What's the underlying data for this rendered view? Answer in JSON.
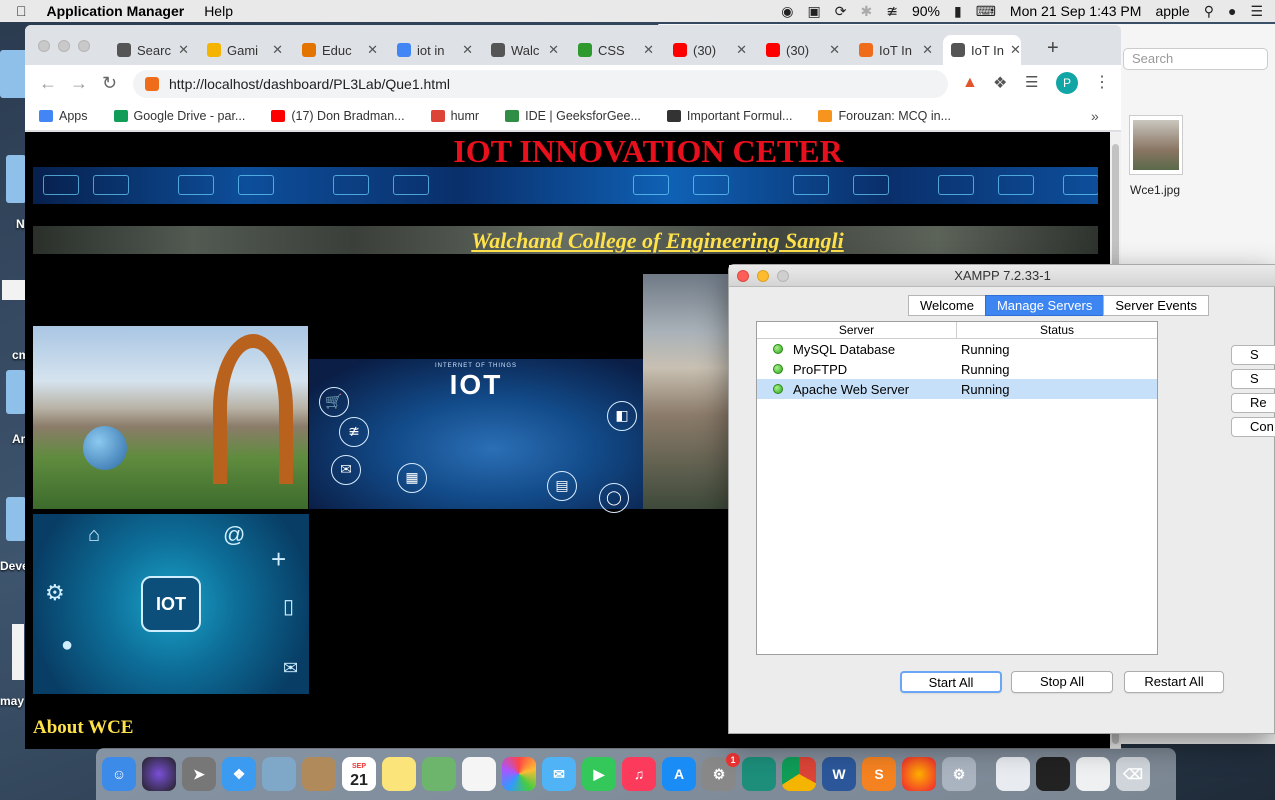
{
  "menubar": {
    "app_name": "Application Manager",
    "menu_help": "Help",
    "battery": "90%",
    "clock": "Mon 21 Sep  1:43 PM",
    "user": "apple"
  },
  "desktop": {
    "labels": [
      "N",
      "cm",
      "Ar",
      "Devel",
      "may"
    ]
  },
  "finder": {
    "search_placeholder": "Search",
    "file_name": "Wce1.jpg"
  },
  "chrome": {
    "tabs": [
      {
        "label": "Searc",
        "color": "#555555"
      },
      {
        "label": "Gami",
        "color": "#f4b400"
      },
      {
        "label": "Educ",
        "color": "#e37400"
      },
      {
        "label": "iot in",
        "color": "#4285f4"
      },
      {
        "label": "Walc",
        "color": "#555555"
      },
      {
        "label": "CSS",
        "color": "#2e9a2e"
      },
      {
        "label": "(30)",
        "color": "#ff0000"
      },
      {
        "label": "(30)",
        "color": "#ff0000"
      },
      {
        "label": "IoT In",
        "color": "#ef6c1a"
      },
      {
        "label": "IoT In",
        "color": "#555555"
      }
    ],
    "url": "http://localhost/dashboard/PL3Lab/Que1.html",
    "profile_initial": "P",
    "bookmarks": [
      {
        "label": "Apps",
        "color": "#4285f4"
      },
      {
        "label": "Google Drive - par...",
        "color": "#0f9d58"
      },
      {
        "label": "(17) Don Bradman...",
        "color": "#ff0000"
      },
      {
        "label": "humr",
        "color": "#db4437"
      },
      {
        "label": "IDE | GeeksforGee...",
        "color": "#2f8d46"
      },
      {
        "label": "Important Formul...",
        "color": "#333333"
      },
      {
        "label": "Forouzan: MCQ in...",
        "color": "#f7941d"
      }
    ]
  },
  "page": {
    "banner_title": "IOT INNOVATION CETER",
    "college_name": "Walchand College of Engineering Sangli",
    "iot_image_text": "IOT",
    "iot_image_subtext": "INTERNET OF THINGS",
    "iot2_image_text": "IOT",
    "about_heading": "About WCE"
  },
  "xampp": {
    "title": "XAMPP 7.2.33-1",
    "tabs": [
      "Welcome",
      "Manage Servers",
      "Server Events"
    ],
    "selected_tab": "Manage Servers",
    "columns": [
      "Server",
      "Status"
    ],
    "servers": [
      {
        "name": "MySQL Database",
        "status": "Running"
      },
      {
        "name": "ProFTPD",
        "status": "Running"
      },
      {
        "name": "Apache Web Server",
        "status": "Running"
      }
    ],
    "side_buttons": [
      "S",
      "S",
      "Re",
      "Con"
    ],
    "buttons": {
      "start_all": "Start All",
      "stop_all": "Stop All",
      "restart_all": "Restart All"
    }
  },
  "dock": {
    "calendar_month": "SEP",
    "calendar_day": "21",
    "badge": "1"
  }
}
